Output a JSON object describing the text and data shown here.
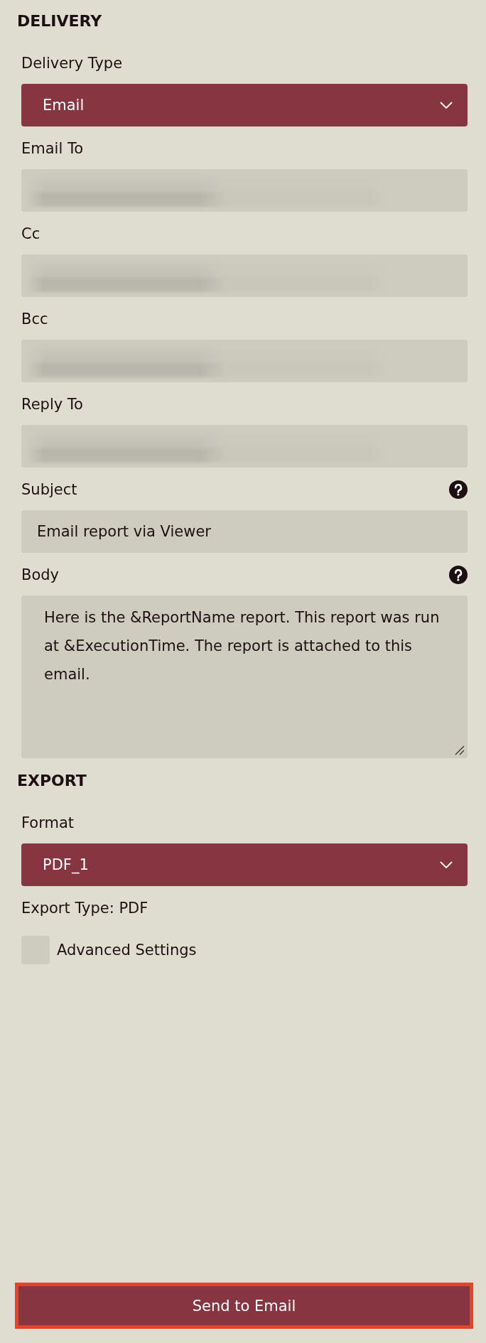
{
  "sections": [
    {
      "title": "DELIVERY",
      "fields": [
        {
          "kind": "select",
          "label": "Delivery Type",
          "value": "Email"
        },
        {
          "kind": "text",
          "label": "Email To",
          "redacted": true
        },
        {
          "kind": "text",
          "label": "Cc",
          "redacted": true
        },
        {
          "kind": "text",
          "label": "Bcc",
          "redacted": true
        },
        {
          "kind": "text",
          "label": "Reply To",
          "redacted": true
        },
        {
          "kind": "text",
          "label": "Subject",
          "value": "Email report via Viewer",
          "help": true
        },
        {
          "kind": "textarea",
          "label": "Body",
          "value": "Here is the &ReportName report. This report was run at &ExecutionTime. The report is attached to this email.",
          "help": true
        }
      ]
    },
    {
      "title": "EXPORT",
      "fields": [
        {
          "kind": "select",
          "label": "Format",
          "value": "PDF_1"
        },
        {
          "kind": "note",
          "text": "Export Type: PDF"
        },
        {
          "kind": "checkbox",
          "label": "Advanced Settings",
          "checked": false
        }
      ]
    }
  ],
  "submit": {
    "label": "Send to Email",
    "focused": true
  }
}
